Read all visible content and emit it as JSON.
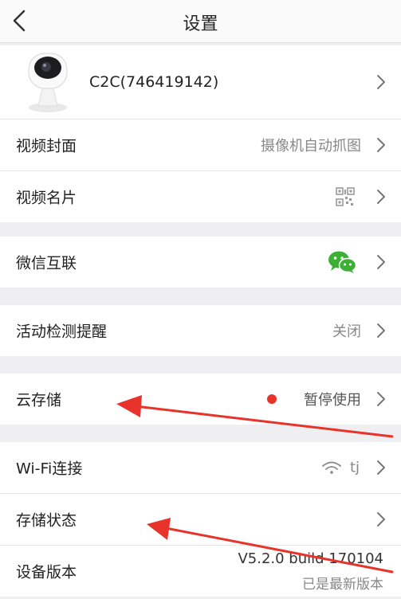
{
  "header": {
    "title": "设置"
  },
  "device": {
    "name": "C2C(746419142)"
  },
  "rows": {
    "video_cover": {
      "label": "视频封面",
      "value": "摄像机自动抓图"
    },
    "video_card": {
      "label": "视频名片"
    },
    "wechat": {
      "label": "微信互联"
    },
    "motion_alert": {
      "label": "活动检测提醒",
      "value": "关闭"
    },
    "cloud_storage": {
      "label": "云存储",
      "value": "暂停使用",
      "status_color": "#e8332b"
    },
    "wifi": {
      "label": "Wi-Fi连接",
      "value": "tj"
    },
    "storage_status": {
      "label": "存储状态"
    },
    "device_version": {
      "label": "设备版本",
      "version": "V5.2.0 build 170104",
      "note": "已是最新版本"
    }
  },
  "colors": {
    "background": "#efeff2",
    "annotation_arrow": "#e8332b",
    "wechat_green": "#3cb034"
  },
  "icons": [
    "back-icon",
    "camera-image",
    "chevron-right-icon",
    "qr-code-icon",
    "wechat-icon",
    "wifi-icon",
    "status-dot"
  ]
}
